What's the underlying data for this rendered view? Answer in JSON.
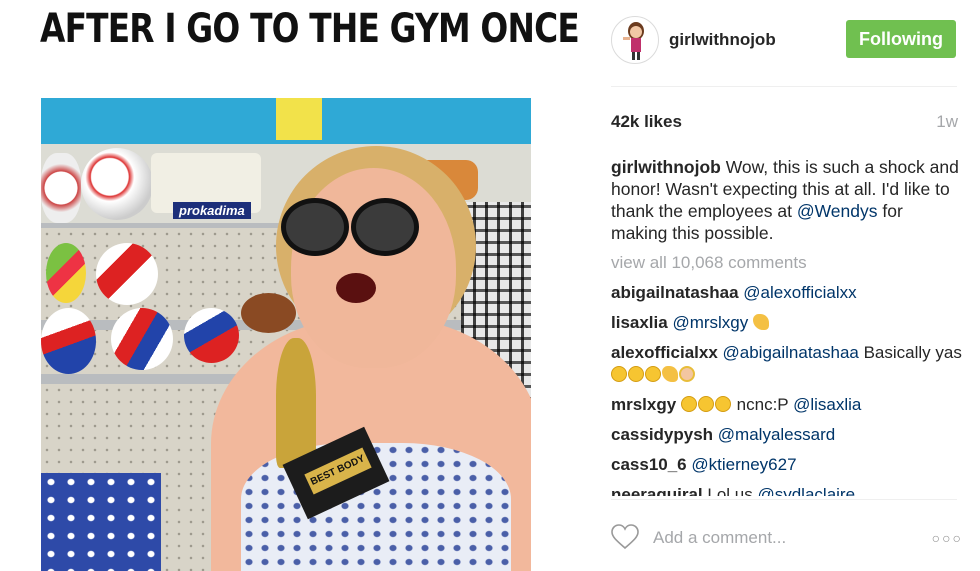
{
  "meme": {
    "title": "AFTER I GO TO THE GYM ONCE",
    "trophy_text": "BEST BODY",
    "brand_label": "prokadima"
  },
  "post": {
    "username": "girlwithnojob",
    "follow_label": "Following",
    "likes": "42k likes",
    "time": "1w",
    "caption": {
      "author": "girlwithnojob",
      "text_before": " Wow, this is such a shock and honor! Wasn't expecting this at all. I'd like to thank the employees at ",
      "mention": "@Wendys",
      "text_after": " for making this possible."
    },
    "view_all": "view all 10,068 comments",
    "comments": [
      {
        "user": "abigailnatashaa",
        "mention": "@alexofficialxx",
        "text": "",
        "emojis": []
      },
      {
        "user": "lisaxlia",
        "mention": "@mrslxgy",
        "text": "",
        "emojis": [
          "arm"
        ]
      },
      {
        "user": "alexofficialxx",
        "mention": "@abigailnatashaa",
        "text": " Basically yas",
        "emojis": [
          "laugh",
          "laugh",
          "laugh",
          "arm",
          "girl"
        ]
      },
      {
        "user": "mrslxgy",
        "mention": "",
        "text": "",
        "emojis": [
          "laugh",
          "laugh",
          "laugh"
        ],
        "text_after": " ncnc:P ",
        "mention_after": "@lisaxlia"
      },
      {
        "user": "cassidypysh",
        "mention": "@malyalessard",
        "text": "",
        "emojis": []
      },
      {
        "user": "cass10_6",
        "mention": "@ktierney627",
        "text": "",
        "emojis": []
      },
      {
        "user": "neeraguiral",
        "mention": "@sydlaclaire",
        "text": " Lol us ",
        "emojis": []
      }
    ],
    "add_comment_placeholder": "Add a comment...",
    "more_icon": "ellipsis-icon",
    "colors": {
      "follow_bg": "#70c050",
      "mention": "#003569",
      "muted": "#a5a7aa"
    }
  }
}
